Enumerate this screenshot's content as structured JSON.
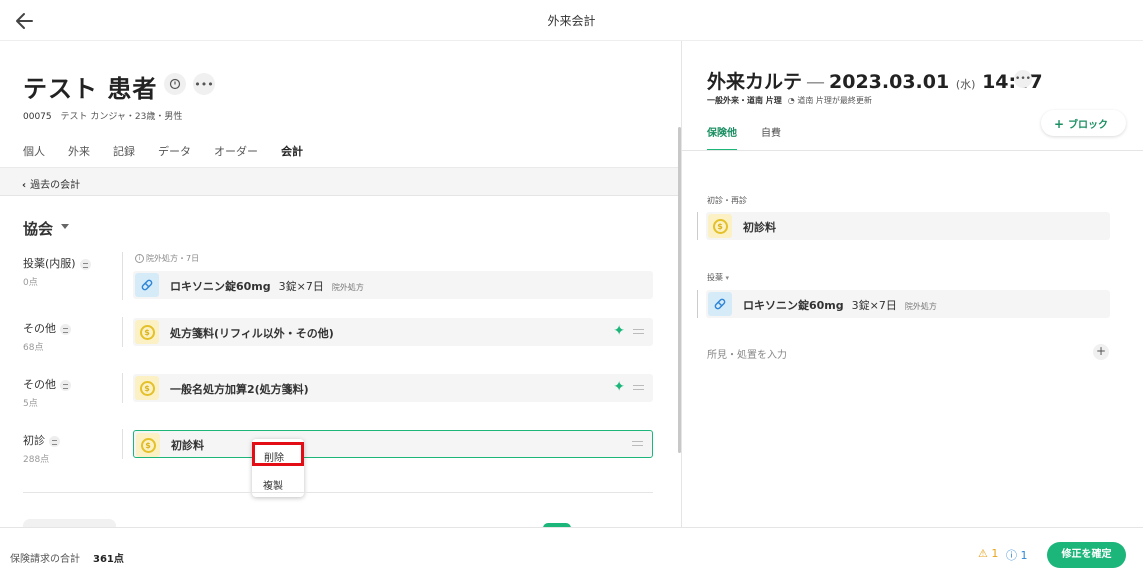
{
  "header": {
    "title": "外来会計"
  },
  "patient": {
    "name": "テスト 患者",
    "id": "00075",
    "details": "テスト カンジャ・23歳・男性"
  },
  "tabs": [
    {
      "label": "個人"
    },
    {
      "label": "外来"
    },
    {
      "label": "記録"
    },
    {
      "label": "データ"
    },
    {
      "label": "オーダー"
    },
    {
      "label": "会計"
    }
  ],
  "past_bar": {
    "label": "過去の会計"
  },
  "org": {
    "title": "協会"
  },
  "categories": [
    {
      "label": "投薬(内服)",
      "points": "0点"
    },
    {
      "label": "その他",
      "points": "68点"
    },
    {
      "label": "その他",
      "points": "5点"
    },
    {
      "label": "初診",
      "points": "288点"
    }
  ],
  "note": "院外処方・7日",
  "items": [
    {
      "name": "ロキソニン錠60mg",
      "qty": "3錠×7日",
      "sub": "院外処方",
      "icon": "pill-icon"
    },
    {
      "name": "処方箋料(リフィル以外・その他)",
      "icon": "coin-icon"
    },
    {
      "name": "一般名処方加算2(処方箋料)",
      "icon": "coin-icon"
    },
    {
      "name": "初診料",
      "icon": "coin-icon"
    }
  ],
  "context_menu": {
    "delete": "削除",
    "duplicate": "複製"
  },
  "karte": {
    "title": "外来カルテ",
    "date": "2023.03.01",
    "dow": "(水)",
    "time": "14:47",
    "type": "一般外来・道南 片理",
    "updated": "道南 片理が最終更新",
    "tabs": [
      {
        "label": "保険他"
      },
      {
        "label": "自費"
      }
    ],
    "block_button": "ブロック",
    "sections": [
      {
        "label": "初診・再診",
        "item": "初診料"
      },
      {
        "label": "投薬",
        "item": "ロキソニン錠60mg",
        "qty": "3錠×7日",
        "sub": "院外処方"
      }
    ],
    "findings_placeholder": "所見・処置を入力"
  },
  "footer": {
    "total_label": "保険請求の合計",
    "total_value": "361点",
    "warning_count": "1",
    "info_count": "1",
    "confirm_button": "修正を確定"
  },
  "colors": {
    "accent": "#1cb57a",
    "highlight": "#e30d16",
    "coin": "#e4c12a",
    "pill": "#2f86d6"
  }
}
